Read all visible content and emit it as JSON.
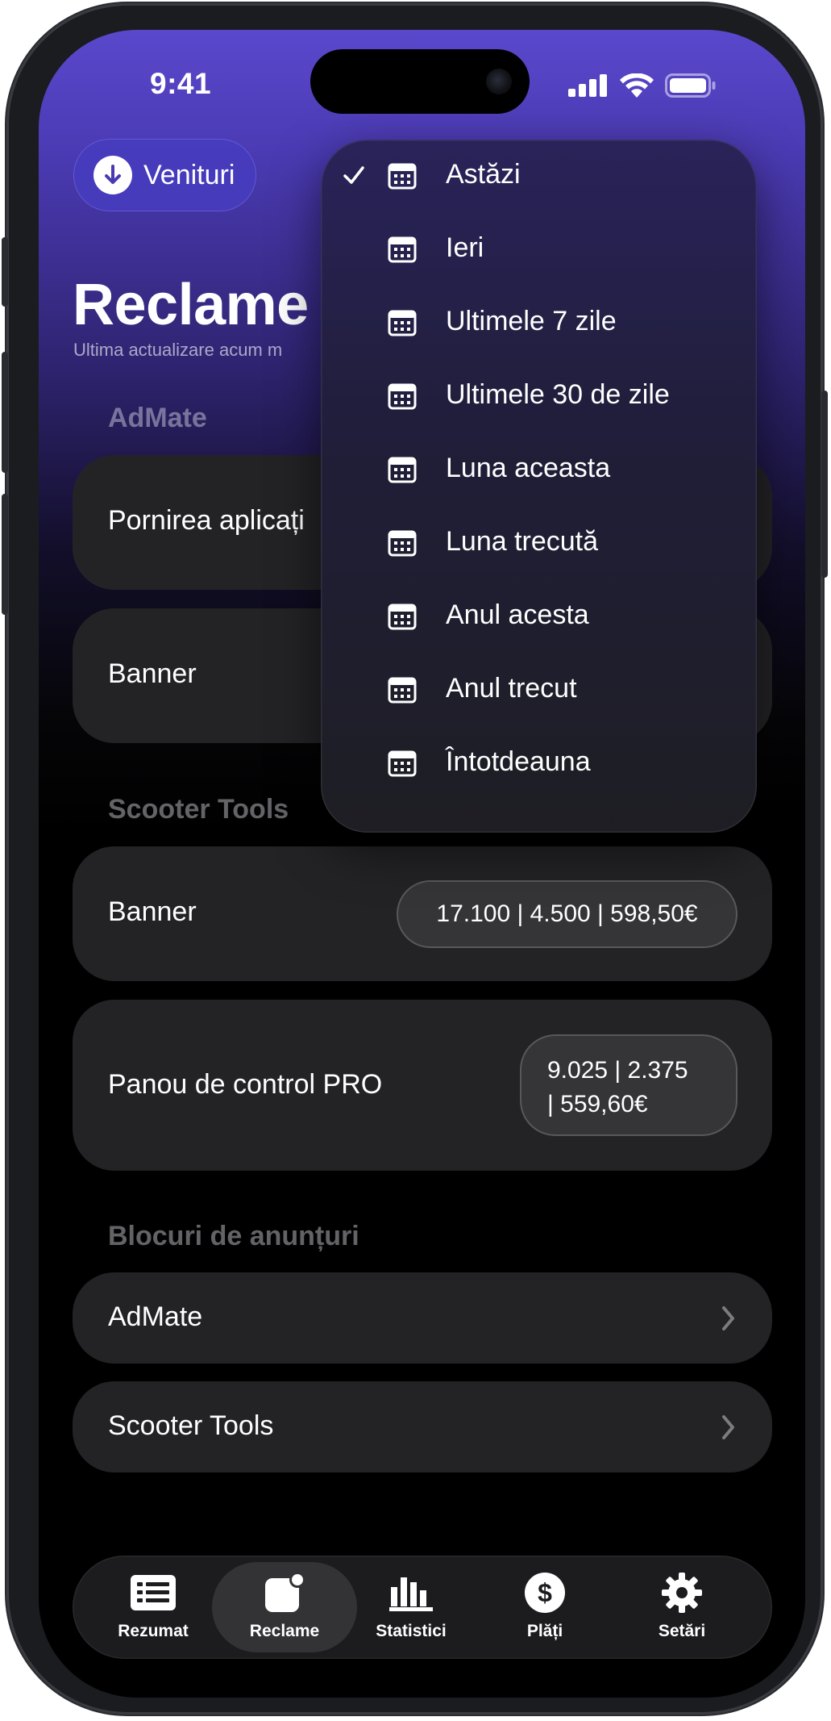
{
  "status_bar": {
    "time": "9:41"
  },
  "header": {
    "revenue_button": "Venituri",
    "title": "Reclame",
    "subtitle": "Ultima actualizare acum m"
  },
  "sections": [
    {
      "title": "AdMate",
      "rows": [
        {
          "label": "Pornirea aplicați"
        },
        {
          "label": "Banner"
        }
      ]
    },
    {
      "title": "Scooter Tools",
      "rows": [
        {
          "label": "Banner",
          "stats": "17.100 | 4.500 | 598,50€"
        },
        {
          "label": "Panou de control PRO",
          "stats_line1": "9.025 | 2.375",
          "stats_line2": "| 559,60€"
        }
      ]
    },
    {
      "title": "Blocuri de anunțuri",
      "rows": [
        {
          "label": "AdMate"
        },
        {
          "label": "Scooter Tools"
        }
      ]
    }
  ],
  "date_menu": {
    "selected_index": 0,
    "items": [
      {
        "label": "Astăzi"
      },
      {
        "label": "Ieri"
      },
      {
        "label": "Ultimele 7 zile"
      },
      {
        "label": "Ultimele 30 de zile"
      },
      {
        "label": "Luna aceasta"
      },
      {
        "label": "Luna trecută"
      },
      {
        "label": "Anul acesta"
      },
      {
        "label": "Anul trecut"
      },
      {
        "label": "Întotdeauna"
      }
    ]
  },
  "tab_bar": {
    "active": "Reclame",
    "tabs": [
      {
        "label": "Rezumat",
        "icon": "list-icon"
      },
      {
        "label": "Reclame",
        "icon": "ads-icon"
      },
      {
        "label": "Statistici",
        "icon": "bar-chart-icon"
      },
      {
        "label": "Plăți",
        "icon": "dollar-icon"
      },
      {
        "label": "Setări",
        "icon": "gear-icon"
      }
    ]
  },
  "colors": {
    "accent": "#4a3ab2",
    "card": "#232326",
    "background": "#000000"
  }
}
